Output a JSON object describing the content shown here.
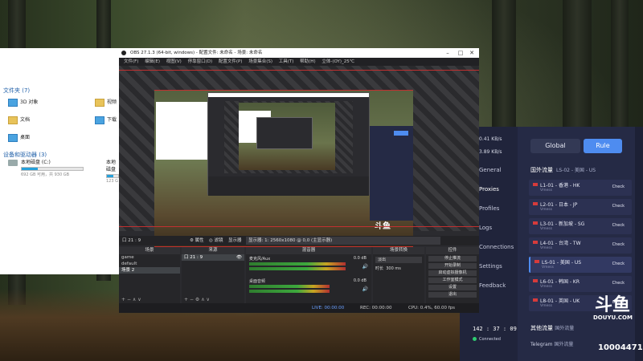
{
  "explorer": {
    "group_folders": "文件夹 (7)",
    "folders": [
      {
        "label": "3D 对象",
        "color": "blue"
      },
      {
        "label": "视频",
        "color": "yellow"
      },
      {
        "label": "文档",
        "color": "yellow"
      },
      {
        "label": "下载",
        "color": "blue"
      },
      {
        "label": "桌面",
        "color": "blue"
      }
    ],
    "group_drives": "设备和驱动器 (3)",
    "drives": [
      {
        "name": "本地磁盘 (C:)",
        "free": "692 GB 可用，共 930 GB",
        "used_fraction": 0.26
      },
      {
        "name": "本地磁盘",
        "free": "123 G",
        "used_fraction": 0.6
      }
    ]
  },
  "obs": {
    "title": "OBS 27.1.3 (64-bit, windows) - 配置文件: 未命名 - 场景: 未命名",
    "window_buttons": [
      "–",
      "□",
      "✕"
    ],
    "menu": [
      "文件(F)",
      "编辑(E)",
      "视图(V)",
      "停靠窗口(D)",
      "配置文件(P)",
      "场景集合(S)",
      "工具(T)",
      "帮助(H)",
      "立体-(OY)_25℃"
    ],
    "scenebar": {
      "source_name": "口 21 : 9",
      "props": "⚙ 属性",
      "filters": "◎ 滤镜",
      "display": "显示器",
      "display_value": "显示器: 1: 2560x1080 @ 0,0 (主显示器)"
    },
    "scenes_dock": {
      "title": "场景",
      "items": [
        "game",
        "default",
        "场景 2"
      ],
      "selected": 2
    },
    "sources_dock": {
      "title": "来源",
      "items": [
        "口 21 : 9"
      ]
    },
    "mixer_dock": {
      "title": "混音器",
      "tracks": [
        "麦克风/Aux",
        "桌面音频"
      ],
      "db": [
        "0.0 dB",
        "0.0 dB"
      ]
    },
    "transitions_dock": {
      "title": "场景转换",
      "type": "淡出",
      "duration_label": "时长",
      "duration": "300 ms"
    },
    "controls_dock": {
      "title": "控件",
      "buttons": [
        "停止推流",
        "开始录制",
        "启动虚拟摄像机",
        "工作室模式",
        "设置",
        "退出"
      ]
    },
    "statusbar": {
      "live": "LIVE: 00:00:00",
      "rec": "REC: 00:00:00",
      "cpu": "CPU: 0.4%, 60.00 fps"
    }
  },
  "proxy": {
    "speed_up": "0.41",
    "speed_down": "3.89",
    "speed_unit": "KB/s",
    "nav": [
      "General",
      "Proxies",
      "Profiles",
      "Logs",
      "Connections",
      "Settings",
      "Feedback"
    ],
    "nav_active": "Proxies",
    "modes": [
      "Global",
      "Rule"
    ],
    "mode_active": "Rule",
    "group_name": "国外流量",
    "group_selected": "LS-02 - 美国 - US",
    "nodes": [
      {
        "name": "L1-01 - 香港 - HK",
        "type": "Vmess",
        "check": "Check"
      },
      {
        "name": "L2-01 - 日本 - JP",
        "type": "Vmess",
        "check": "Check"
      },
      {
        "name": "L3-01 - 新加坡 - SG",
        "type": "Vmess",
        "check": "Check"
      },
      {
        "name": "L4-01 - 台湾 - TW",
        "type": "Vmess",
        "check": "Check"
      },
      {
        "name": "LS-01 - 美国 - US",
        "type": "Vmess",
        "check": "Check"
      },
      {
        "name": "L6-01 - 韩国 - KR",
        "type": "Vmess",
        "check": "Check"
      },
      {
        "name": "L8-01 - 英国 - UK",
        "type": "Vmess",
        "check": "Check"
      }
    ],
    "group2_name": "其他流量",
    "group2_selected": "国外流量",
    "telegram": "Telegram",
    "telegram_sel": "国外流量",
    "timer": "142 : 37 : 09",
    "connected": "Connected"
  },
  "watermark": {
    "brand": "斗鱼",
    "site": "DOUYU.COM",
    "room": "10004471"
  }
}
